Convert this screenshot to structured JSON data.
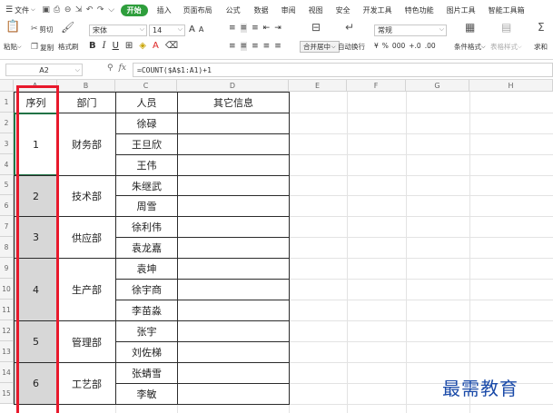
{
  "ribbon": {
    "file_menu": "文件",
    "quick_access_icons": [
      "save-icon",
      "print-icon",
      "print-preview-icon",
      "export-icon",
      "undo-icon",
      "redo-icon",
      "dropdown-icon"
    ],
    "active_tab": "开始",
    "tabs": [
      "插入",
      "页面布局",
      "公式",
      "数据",
      "审阅",
      "视图",
      "安全",
      "开发工具",
      "特色功能",
      "图片工具",
      "智能工具箱"
    ],
    "paste_label": "粘贴",
    "cut_label": "剪切",
    "copy_label": "复制",
    "format_painter_label": "格式刷",
    "font_name": "宋体",
    "font_size": "14",
    "grow_font": "A",
    "shrink_font": "A",
    "bold": "B",
    "italic": "I",
    "underline": "U",
    "merge_label": "合并居中",
    "wrap_label": "自动换行",
    "number_format": "常规",
    "currency": "¥",
    "percent": "%",
    "thousands": "000",
    "inc_decimal": "+.0",
    "dec_decimal": ".00",
    "conditional_label": "条件格式",
    "table_style_label": "表格样式",
    "sum_label": "求和"
  },
  "formula_bar": {
    "name_box": "A2",
    "formula": "=COUNT($A$1:A1)+1"
  },
  "columns": [
    "A",
    "B",
    "C",
    "D",
    "E",
    "F",
    "G",
    "H"
  ],
  "rows": [
    "1",
    "2",
    "3",
    "4",
    "5",
    "6",
    "7",
    "8",
    "9",
    "10",
    "11",
    "12",
    "13",
    "14",
    "15"
  ],
  "table": {
    "headers": {
      "seq": "序列",
      "dept": "部门",
      "person": "人员",
      "other": "其它信息"
    },
    "groups": [
      {
        "seq": "1",
        "dept": "财务部",
        "people": [
          "徐碌",
          "王旦欣",
          "王伟"
        ]
      },
      {
        "seq": "2",
        "dept": "技术部",
        "people": [
          "朱继武",
          "周雪"
        ]
      },
      {
        "seq": "3",
        "dept": "供应部",
        "people": [
          "徐利伟",
          "袁龙嘉"
        ]
      },
      {
        "seq": "4",
        "dept": "生产部",
        "people": [
          "袁坤",
          "徐宇商",
          "李苗淼"
        ]
      },
      {
        "seq": "5",
        "dept": "管理部",
        "people": [
          "张宇",
          "刘佐梯"
        ]
      },
      {
        "seq": "6",
        "dept": "工艺部",
        "people": [
          "张蜻雪",
          "李敏"
        ]
      }
    ]
  },
  "watermark": "最需教育",
  "colors": {
    "accent_green": "#2e9e3c",
    "highlight_red": "#e8192c",
    "selection_gray": "#d7d7d7",
    "watermark_blue": "#1a4aa8"
  }
}
